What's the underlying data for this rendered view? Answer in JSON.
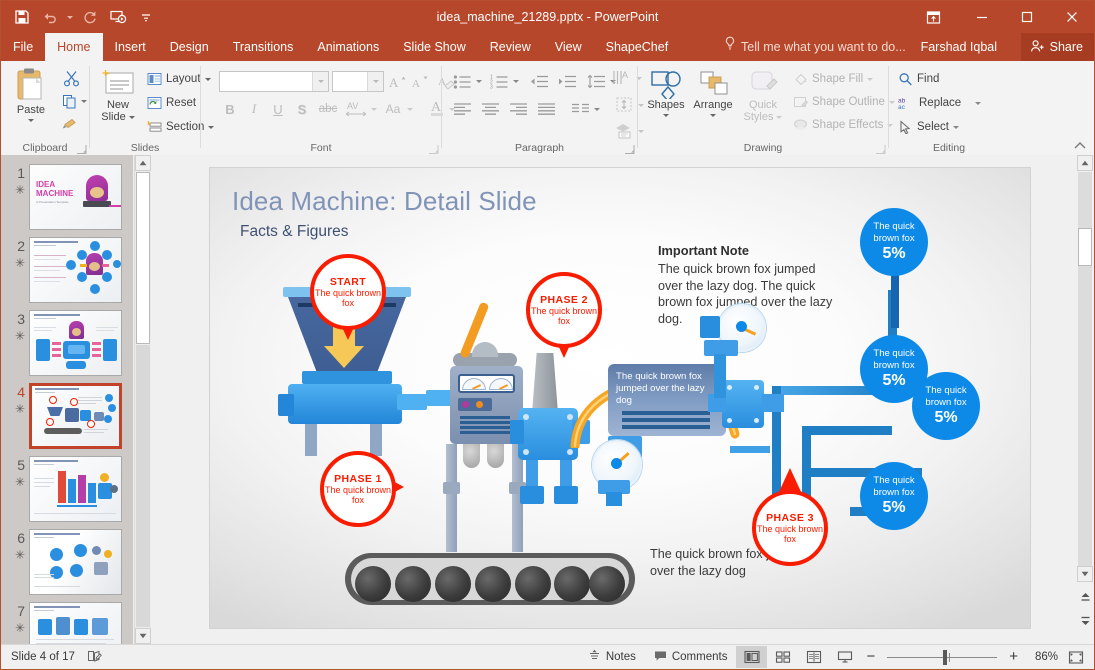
{
  "window": {
    "title": "idea_machine_21289.pptx - PowerPoint",
    "accent_color": "#b7472a",
    "quick_access": [
      {
        "name": "save-icon",
        "label": "Save"
      },
      {
        "name": "undo-icon",
        "label": "Undo"
      },
      {
        "name": "redo-icon",
        "label": "Repeat"
      },
      {
        "name": "start-presentation-icon",
        "label": "Start From Beginning"
      },
      {
        "name": "customize-qat-icon",
        "label": "Customize Quick Access Toolbar"
      }
    ],
    "controls": [
      {
        "name": "ribbon-display-options-icon",
        "label": "Ribbon Display Options"
      },
      {
        "name": "minimize-icon",
        "label": "Minimize"
      },
      {
        "name": "restore-icon",
        "label": "Restore Down"
      },
      {
        "name": "close-icon",
        "label": "Close"
      }
    ]
  },
  "tabs": [
    {
      "label": "File",
      "active": false
    },
    {
      "label": "Home",
      "active": true
    },
    {
      "label": "Insert",
      "active": false
    },
    {
      "label": "Design",
      "active": false
    },
    {
      "label": "Transitions",
      "active": false
    },
    {
      "label": "Animations",
      "active": false
    },
    {
      "label": "Slide Show",
      "active": false
    },
    {
      "label": "Review",
      "active": false
    },
    {
      "label": "View",
      "active": false
    },
    {
      "label": "ShapeChef",
      "active": false
    }
  ],
  "tellme": {
    "placeholder": "Tell me what you want to do..."
  },
  "account": {
    "user": "Farshad Iqbal",
    "share_label": "Share"
  },
  "ribbon": {
    "clipboard": {
      "label": "Clipboard",
      "paste": "Paste",
      "cut": "Cut",
      "copy": "Copy",
      "format_painter": "Format Painter"
    },
    "slides": {
      "label": "Slides",
      "new_slide": "New\nSlide",
      "new_slide_line1": "New",
      "new_slide_line2": "Slide",
      "layout": "Layout",
      "reset": "Reset",
      "section": "Section"
    },
    "font": {
      "label": "Font",
      "font_name": "",
      "font_name_placeholder": "",
      "font_size": "",
      "font_size_placeholder": "",
      "grow": "Increase Font Size",
      "shrink": "Decrease Font Size",
      "clear": "Clear All Formatting",
      "bold": "B",
      "italic": "I",
      "underline": "U",
      "shadow": "S",
      "strike": "abc",
      "spacing": "AV",
      "case": "Aa",
      "color": "A"
    },
    "paragraph": {
      "label": "Paragraph",
      "bullets": "Bullets",
      "numbering": "Numbering",
      "decrease_indent": "Decrease List Level",
      "increase_indent": "Increase List Level",
      "line_spacing": "Line Spacing",
      "text_direction": "Text Direction",
      "align_text": "Align Text",
      "convert_smartart": "Convert to SmartArt",
      "align_left": "Align Left",
      "center": "Center",
      "align_right": "Align Right",
      "justify": "Justify",
      "columns": "Columns"
    },
    "drawing": {
      "label": "Drawing",
      "shapes": "Shapes",
      "arrange": "Arrange",
      "quick_styles_line1": "Quick",
      "quick_styles_line2": "Styles",
      "shape_fill": "Shape Fill",
      "shape_outline": "Shape Outline",
      "shape_effects": "Shape Effects"
    },
    "editing": {
      "label": "Editing",
      "find": "Find",
      "replace": "Replace",
      "select": "Select"
    },
    "collapse": "Collapse the Ribbon"
  },
  "thumbnails": [
    {
      "number": "1",
      "star": "✳"
    },
    {
      "number": "2",
      "star": "✳"
    },
    {
      "number": "3",
      "star": "✳"
    },
    {
      "number": "4",
      "star": "✳",
      "selected": true
    },
    {
      "number": "5",
      "star": "✳"
    },
    {
      "number": "6",
      "star": "✳"
    },
    {
      "number": "7",
      "star": "✳"
    }
  ],
  "slide": {
    "title": "Idea Machine: Detail Slide",
    "subtitle": "Facts & Figures",
    "note_heading": "Important Note",
    "note_body": "The quick brown fox jumped over the lazy dog. The quick brown fox jumped over the lazy dog.",
    "bottom_caption": "The quick brown fox jumped over the lazy dog",
    "machine_label": "The quick brown fox jumped over the lazy dog",
    "pins": [
      {
        "heading": "START",
        "text": "The quick brown fox",
        "direction": "down"
      },
      {
        "heading": "PHASE 2",
        "text": "The quick brown fox",
        "direction": "down"
      },
      {
        "heading": "PHASE 1",
        "text": "The quick brown fox",
        "direction": "right"
      },
      {
        "heading": "PHASE 3",
        "text": "The quick brown fox",
        "direction": "up"
      }
    ],
    "badges": [
      {
        "text": "The quick brown fox",
        "percent": "5%"
      },
      {
        "text": "The quick brown fox",
        "percent": "5%"
      },
      {
        "text": "The quick brown fox",
        "percent": "5%"
      },
      {
        "text": "The quick brown fox",
        "percent": "5%"
      }
    ],
    "colors": {
      "title": "#8194b8",
      "subtitle": "#3f5172",
      "pin_red": "#f81c00",
      "badge_blue": "#0d8ae8",
      "machine_blue": "#2a8fe0"
    }
  },
  "status": {
    "slide_indicator": "Slide 4 of 17",
    "notes_label": "Notes",
    "comments_label": "Comments",
    "zoom_percent": "86%",
    "views": [
      {
        "name": "normal-view-button",
        "selected": true
      },
      {
        "name": "slide-sorter-view-button",
        "selected": false
      },
      {
        "name": "reading-view-button",
        "selected": false
      },
      {
        "name": "slide-show-button",
        "selected": false
      }
    ],
    "zoom_out_label": "−",
    "zoom_in_label": "+"
  }
}
